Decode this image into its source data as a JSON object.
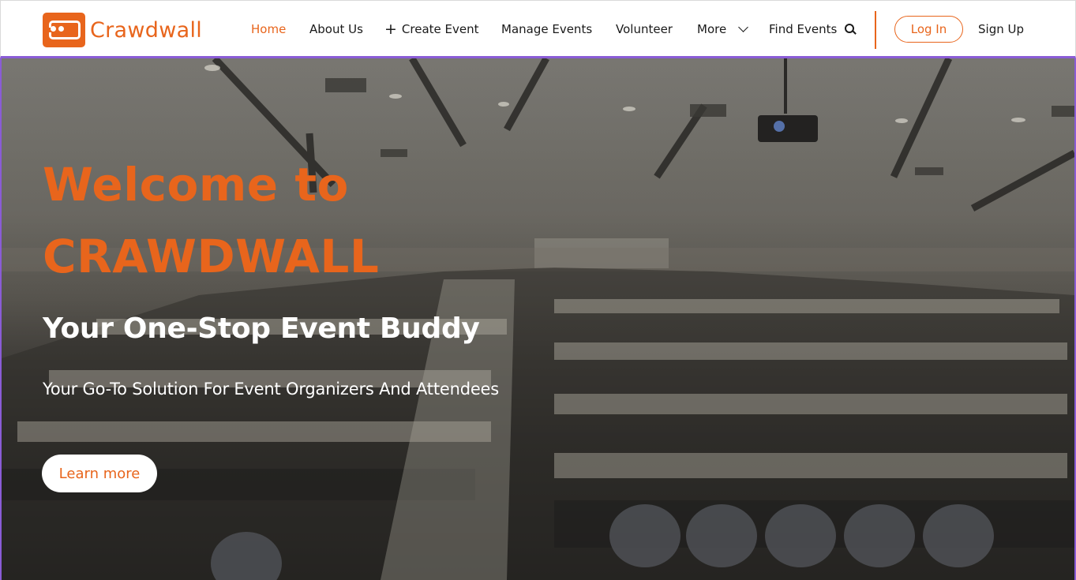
{
  "brand": {
    "name": "Crawdwall",
    "accent": "#e8651c",
    "highlight": "#8a5cd6"
  },
  "nav": {
    "items": [
      {
        "label": "Home",
        "active": true
      },
      {
        "label": "About Us"
      },
      {
        "label": "Create Event",
        "icon": "plus-icon"
      },
      {
        "label": "Manage Events"
      },
      {
        "label": "Volunteer"
      },
      {
        "label": "More",
        "icon": "chevron-down-icon"
      },
      {
        "label": "Find Events",
        "icon": "search-icon"
      }
    ],
    "login_label": "Log In",
    "signup_label": "Sign Up"
  },
  "hero": {
    "title_line1": "Welcome to",
    "title_line2": "CRAWDWALL",
    "subtitle": "Your One-Stop Event Buddy",
    "tagline": "Your Go-To Solution For Event Organizers And Attendees",
    "cta_label": "Learn more",
    "background": "lecture-hall-crowd-photo"
  }
}
